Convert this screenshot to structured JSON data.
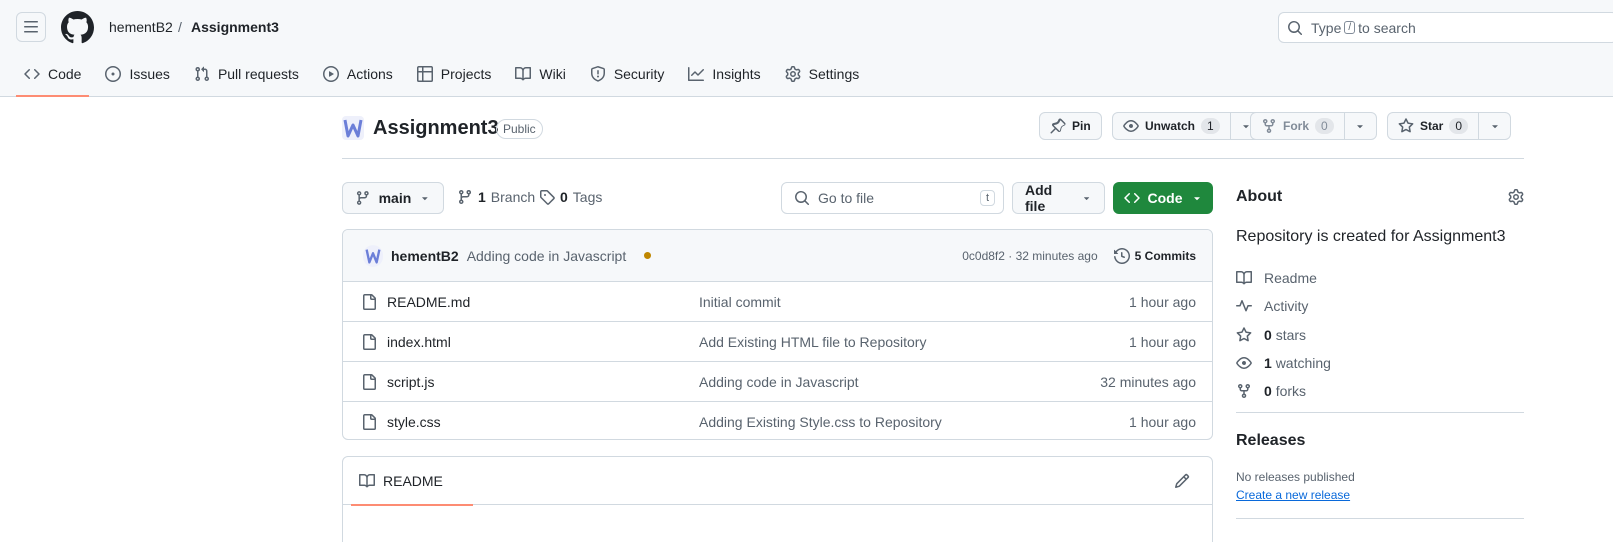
{
  "header": {
    "owner": "hementB2",
    "separator": "/",
    "repo": "Assignment3",
    "search": {
      "before": "Type",
      "key": "/",
      "after": "to search"
    }
  },
  "tabs": [
    {
      "label": "Code",
      "icon": "code-icon",
      "active": true
    },
    {
      "label": "Issues",
      "icon": "issue-icon"
    },
    {
      "label": "Pull requests",
      "icon": "pull-request-icon"
    },
    {
      "label": "Actions",
      "icon": "play-icon"
    },
    {
      "label": "Projects",
      "icon": "table-icon"
    },
    {
      "label": "Wiki",
      "icon": "book-icon"
    },
    {
      "label": "Security",
      "icon": "shield-icon"
    },
    {
      "label": "Insights",
      "icon": "graph-icon"
    },
    {
      "label": "Settings",
      "icon": "gear-icon"
    }
  ],
  "repo_head": {
    "name": "Assignment3",
    "visibility": "Public",
    "pin": "Pin",
    "unwatch": "Unwatch",
    "unwatch_count": "1",
    "fork": "Fork",
    "fork_count": "0",
    "star": "Star",
    "star_count": "0"
  },
  "toolbar": {
    "branch": "main",
    "branches_count": "1",
    "branches_label": "Branch",
    "tags_count": "0",
    "tags_label": "Tags",
    "goto_placeholder": "Go to file",
    "goto_key": "t",
    "add_file": "Add file",
    "code": "Code"
  },
  "commit": {
    "author": "hementB2",
    "message": "Adding code in Javascript",
    "meta": "0c0d8f2 · 32 minutes ago",
    "commits": "5 Commits",
    "status_color": "#bf8700"
  },
  "files": [
    {
      "name": "README.md",
      "message": "Initial commit",
      "age": "1 hour ago"
    },
    {
      "name": "index.html",
      "message": "Add Existing HTML file to Repository",
      "age": "1 hour ago"
    },
    {
      "name": "script.js",
      "message": "Adding code in Javascript",
      "age": "32 minutes ago"
    },
    {
      "name": "style.css",
      "message": "Adding Existing Style.css to Repository",
      "age": "1 hour ago"
    }
  ],
  "readme": {
    "tab": "README"
  },
  "about": {
    "title": "About",
    "description": "Repository is created for Assignment3",
    "readme": "Readme",
    "activity": "Activity",
    "stars_count": "0",
    "stars_label": "stars",
    "watching_count": "1",
    "watching_label": "watching",
    "forks_count": "0",
    "forks_label": "forks"
  },
  "releases": {
    "title": "Releases",
    "none": "No releases published",
    "create": "Create a new release"
  },
  "colors": {
    "accent": "#1f883d",
    "tab_underline": "#fd8c73",
    "link": "#0969da"
  }
}
